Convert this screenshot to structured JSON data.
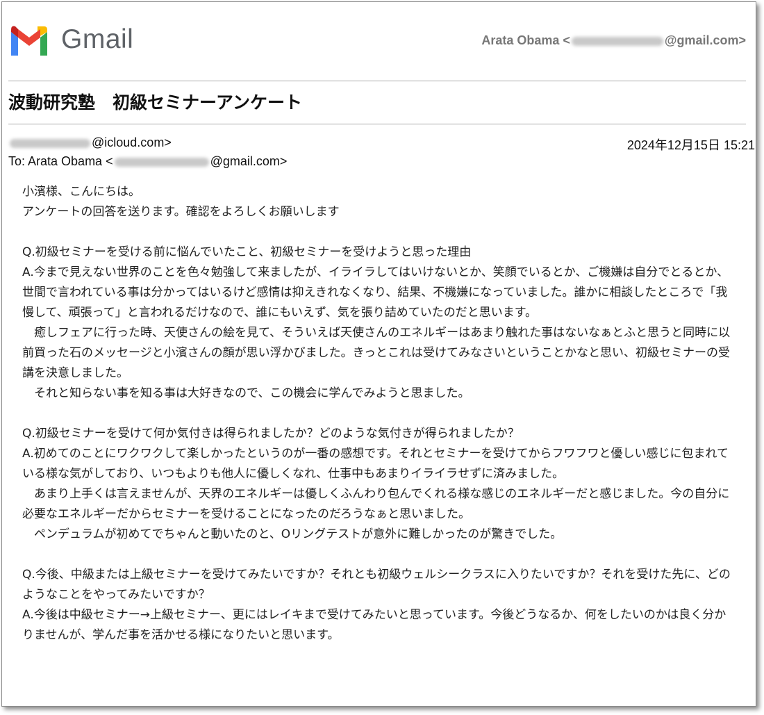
{
  "header": {
    "logo_text": "Gmail",
    "account_name": "Arata Obama <",
    "account_domain": "@gmail.com>"
  },
  "subject": "波動研究塾　初級セミナーアンケート",
  "from": {
    "domain": "@icloud.com>"
  },
  "to": {
    "prefix": "To: Arata Obama <",
    "domain": "@gmail.com>"
  },
  "date": "2024年12月15日 15:21",
  "body": {
    "greeting": "小濱様、こんにちは。",
    "intro": "アンケートの回答を送ります。確認をよろしくお願いします",
    "q1": "Q.初級セミナーを受ける前に悩んでいたこと、初級セミナーを受けようと思った理由",
    "a1_p1": "A.今まで見えない世界のことを色々勉強して来ましたが、イライラしてはいけないとか、笑顔でいるとか、ご機嫌は自分でとるとか、世間で言われている事は分かってはいるけど感情は抑えきれなくなり、結果、不機嫌になっていました。誰かに相談したところで「我慢して、頑張って」と言われるだけなので、誰にもいえず、気を張り詰めていたのだと思います。",
    "a1_p2": "　癒しフェアに行った時、天使さんの絵を見て、そういえば天使さんのエネルギーはあまり触れた事はないなぁとふと思うと同時に以前買った石のメッセージと小濱さんの顔が思い浮かびました。きっとこれは受けてみなさいということかなと思い、初級セミナーの受講を決意しました。",
    "a1_p3": "　それと知らない事を知る事は大好きなので、この機会に学んでみようと思ました。",
    "q2": "Q.初級セミナーを受けて何か気付きは得られましたか？どのような気付きが得られましたか？",
    "a2_p1": "A.初めてのことにワクワクして楽しかったというのが一番の感想です。それとセミナーを受けてからフワフワと優しい感じに包まれている様な気がしており、いつもよりも他人に優しくなれ、仕事中もあまりイライラせずに済みました。",
    "a2_p2": "　あまり上手くは言えませんが、天界のエネルギーは優しくふんわり包んでくれる様な感じのエネルギーだと感じました。今の自分に必要なエネルギーだからセミナーを受けることになったのだろうなぁと思いました。",
    "a2_p3": "　ペンデュラムが初めてでちゃんと動いたのと、Oリングテストが意外に難しかったのが驚きでした。",
    "q3": "Q.今後、中級または上級セミナーを受けてみたいですか？それとも初級ウェルシークラスに入りたいですか？それを受けた先に、どのようなことをやってみたいですか？",
    "a3_p1": "A.今後は中級セミナー→上級セミナー、更にはレイキまで受けてみたいと思っています。今後どうなるか、何をしたいのかは良く分かりませんが、学んだ事を活かせる様になりたいと思います。"
  },
  "colors": {
    "logo_red": "#ea4335",
    "logo_blue": "#4285f4",
    "logo_green": "#34a853",
    "logo_yellow": "#fbbc04",
    "logo_darkred": "#c5221f",
    "logo_text": "#5f6368"
  }
}
